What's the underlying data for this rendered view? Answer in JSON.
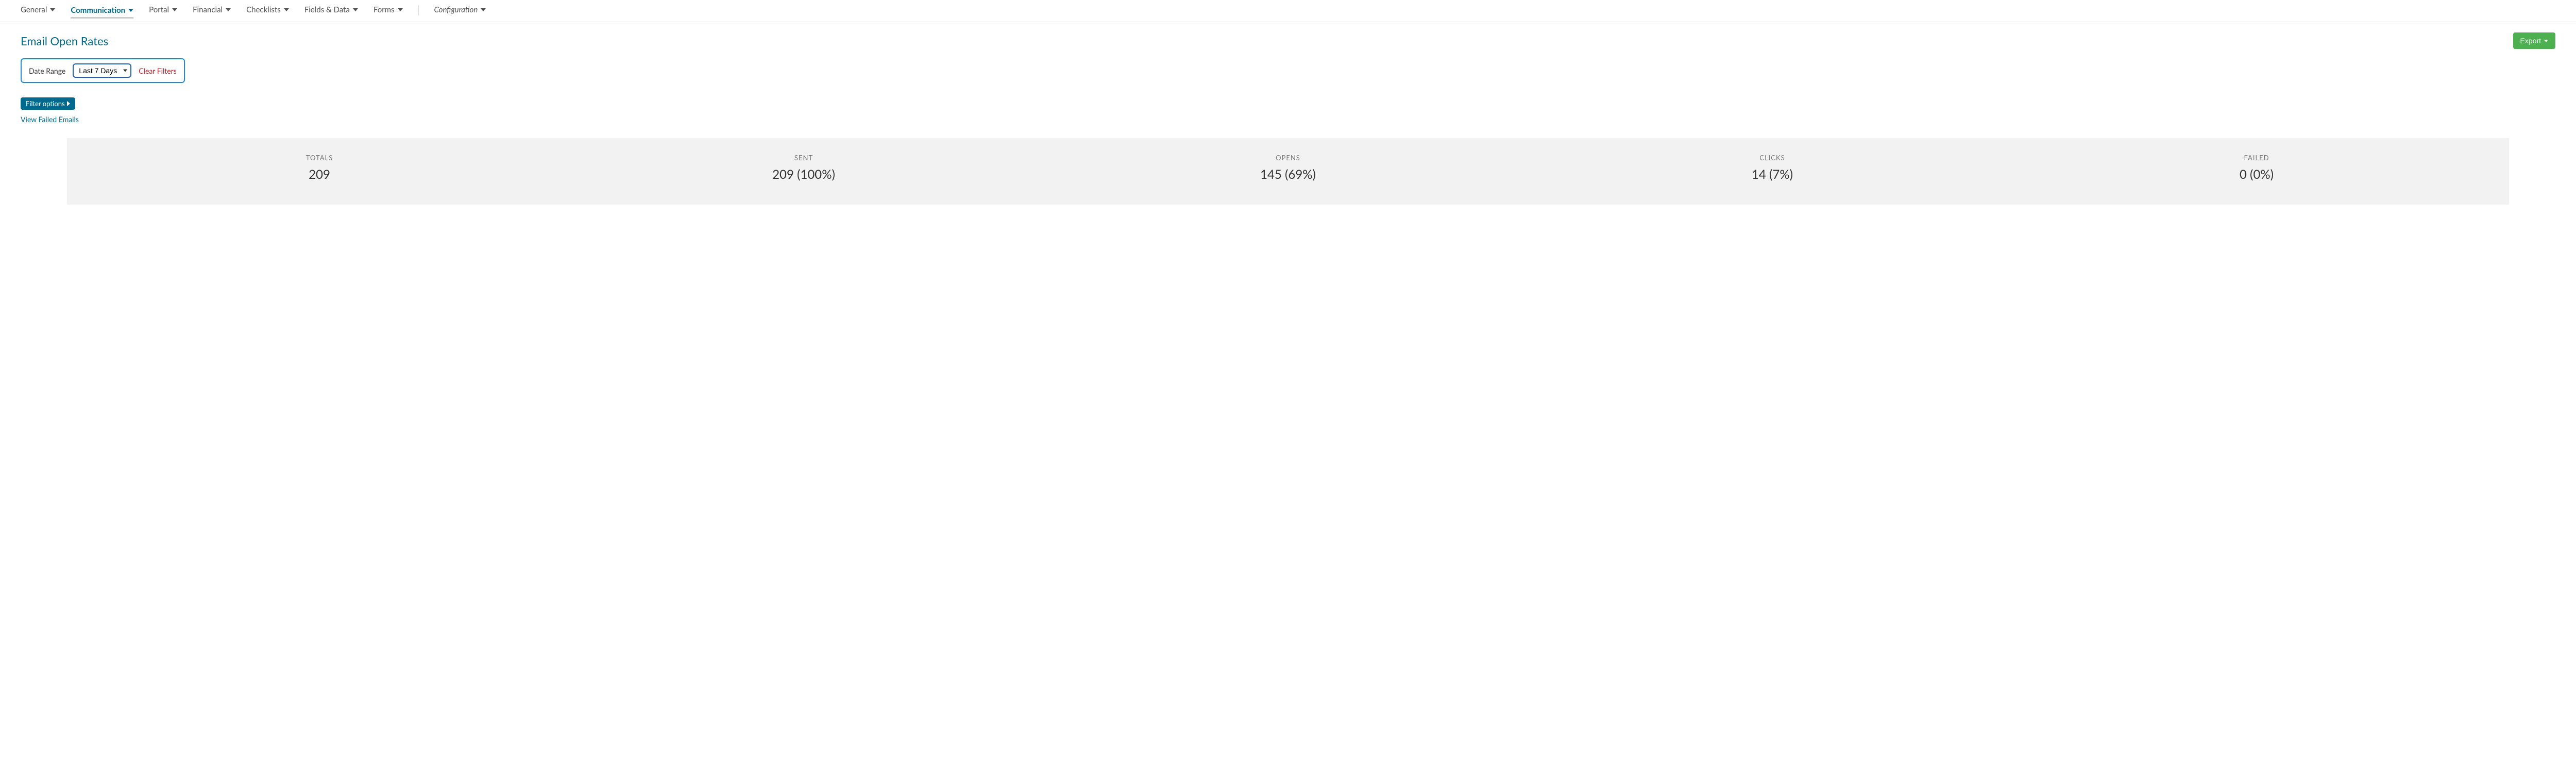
{
  "nav": {
    "items": [
      {
        "label": "General",
        "active": false,
        "config": false
      },
      {
        "label": "Communication",
        "active": true,
        "config": false
      },
      {
        "label": "Portal",
        "active": false,
        "config": false
      },
      {
        "label": "Financial",
        "active": false,
        "config": false
      },
      {
        "label": "Checklists",
        "active": false,
        "config": false
      },
      {
        "label": "Fields & Data",
        "active": false,
        "config": false
      },
      {
        "label": "Forms",
        "active": false,
        "config": false
      },
      {
        "label": "Configuration",
        "active": false,
        "config": true
      }
    ]
  },
  "page": {
    "title": "Email Open Rates",
    "export_label": "Export"
  },
  "filters": {
    "date_range_label": "Date Range",
    "date_range_value": "Last 7 Days",
    "clear_label": "Clear Filters",
    "filter_options_label": "Filter options",
    "view_failed_label": "View Failed Emails"
  },
  "stats": {
    "columns": [
      {
        "label": "TOTALS",
        "value": "209"
      },
      {
        "label": "SENT",
        "value": "209 (100%)"
      },
      {
        "label": "OPENS",
        "value": "145 (69%)"
      },
      {
        "label": "CLICKS",
        "value": "14 (7%)"
      },
      {
        "label": "FAILED",
        "value": "0 (0%)"
      }
    ]
  }
}
